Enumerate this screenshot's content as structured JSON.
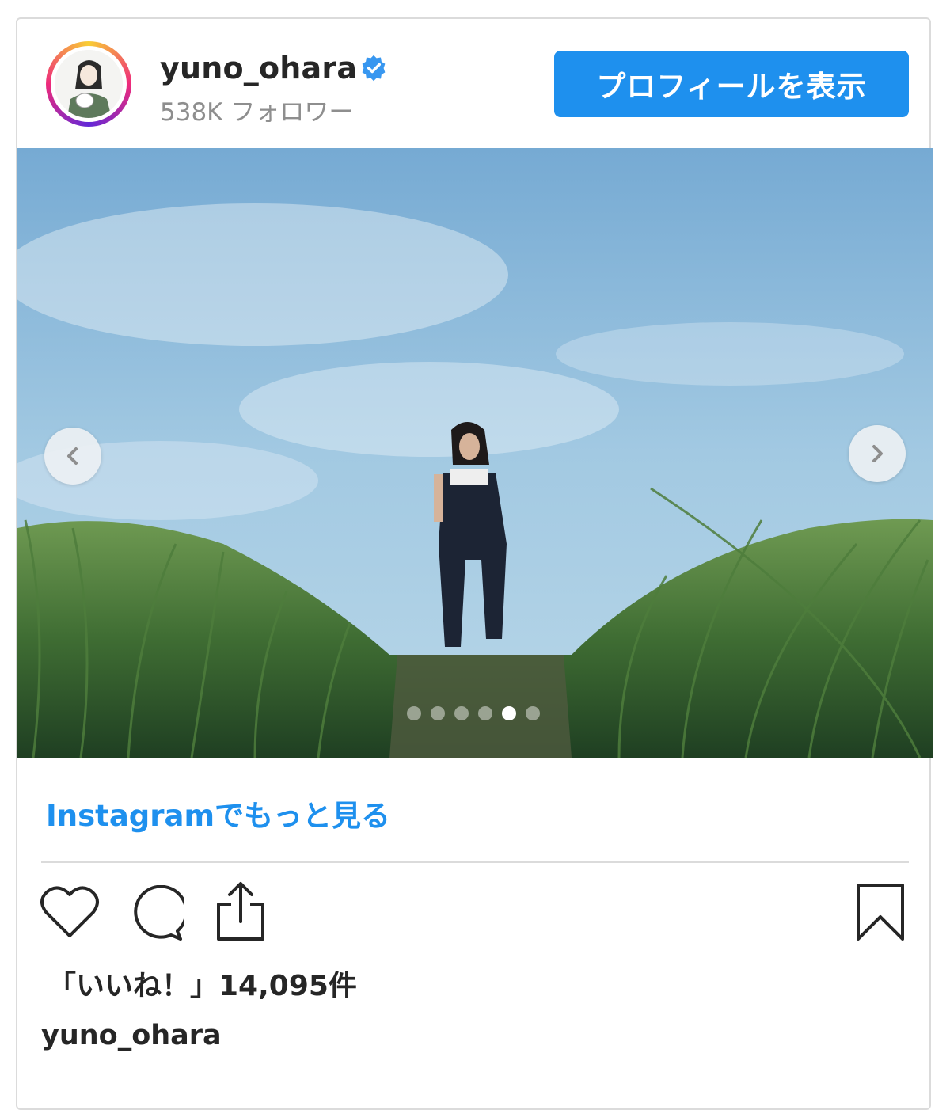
{
  "header": {
    "username": "yuno_ohara",
    "followers": "538K フォロワー",
    "profile_button_label": "プロフィールを表示"
  },
  "carousel": {
    "slide_count": 6,
    "active_index": 4
  },
  "footer": {
    "more_link": "Instagramでもっと見る",
    "likes": "「いいね！」14,095件",
    "caption_username": "yuno_ohara"
  },
  "colors": {
    "accent": "#1e90ee",
    "text": "#262626",
    "muted": "#8e8e8e",
    "border": "#dbdbdb"
  },
  "icons": [
    "verified-badge-icon",
    "chevron-left-icon",
    "chevron-right-icon",
    "heart-icon",
    "comment-icon",
    "share-icon",
    "bookmark-icon"
  ]
}
